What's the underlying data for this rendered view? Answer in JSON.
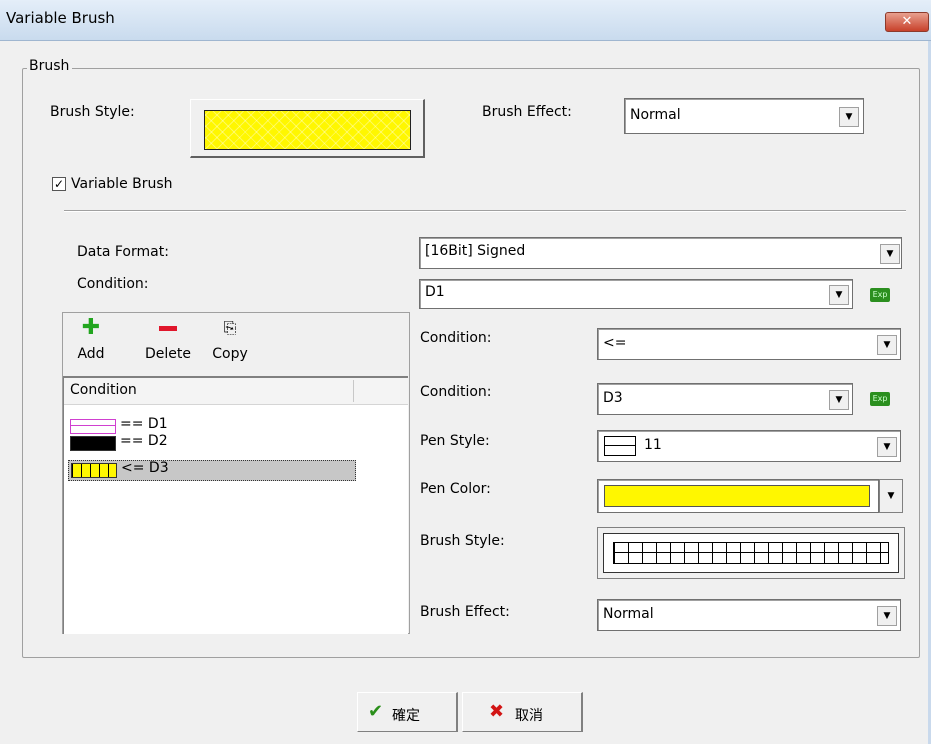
{
  "window": {
    "title": "Variable Brush",
    "close_label": "✕"
  },
  "group": {
    "label": "Brush"
  },
  "top": {
    "brush_style_label": "Brush Style:",
    "brush_effect_label": "Brush Effect:",
    "brush_effect_value": "Normal",
    "brush_color": "#fff700"
  },
  "variable_brush": {
    "label": "Variable Brush",
    "checked": true,
    "check_mark": "✓"
  },
  "form": {
    "data_format_label": "Data Format:",
    "data_format_value": "[16Bit] Signed",
    "condition_label": "Condition:",
    "condition_value": "D1",
    "exp_icon_text": "Exp"
  },
  "toolbar": {
    "add_label": "Add",
    "delete_label": "Delete",
    "copy_label": "Copy"
  },
  "list": {
    "column_header": "Condition",
    "rows": [
      {
        "text": "== D1",
        "swatch": "pink-outline"
      },
      {
        "text": "== D2",
        "swatch": "black"
      },
      {
        "text": "<= D3",
        "swatch": "yellow-vlines",
        "selected": true
      }
    ]
  },
  "right": {
    "operator_label": "Condition:",
    "operator_value": "<=",
    "operand_label": "Condition:",
    "operand_value": "D3",
    "pen_style_label": "Pen Style:",
    "pen_style_value": "11",
    "pen_color_label": "Pen Color:",
    "pen_color": "#fff700",
    "brush_style_label": "Brush Style:",
    "brush_effect_label": "Brush Effect:",
    "brush_effect_value": "Normal"
  },
  "buttons": {
    "ok_label": "確定",
    "cancel_label": "取消"
  }
}
